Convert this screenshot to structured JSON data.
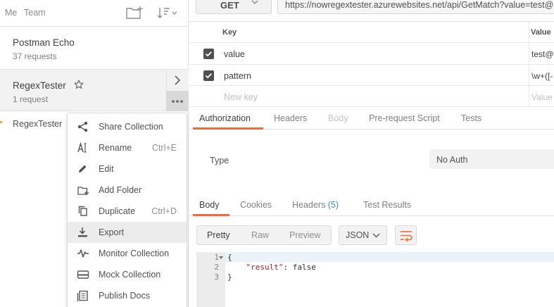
{
  "sidebar": {
    "tabs": {
      "me": "Me",
      "team": "Team"
    },
    "collections": [
      {
        "name": "Postman Echo",
        "sub": "37 requests"
      },
      {
        "name": "RegexTester",
        "sub": "1 request"
      }
    ],
    "request": {
      "name": "RegexTester"
    }
  },
  "context_menu": {
    "items": [
      {
        "label": "Share Collection",
        "shortcut": "",
        "icon": "share-icon"
      },
      {
        "label": "Rename",
        "shortcut": "Ctrl+E",
        "icon": "rename-icon"
      },
      {
        "label": "Edit",
        "shortcut": "",
        "icon": "pencil-icon"
      },
      {
        "label": "Add Folder",
        "shortcut": "",
        "icon": "add-folder-icon"
      },
      {
        "label": "Duplicate",
        "shortcut": "Ctrl+D",
        "icon": "duplicate-icon"
      },
      {
        "label": "Export",
        "shortcut": "",
        "icon": "export-icon",
        "highlighted": true
      },
      {
        "label": "Monitor Collection",
        "shortcut": "",
        "icon": "monitor-icon"
      },
      {
        "label": "Mock Collection",
        "shortcut": "",
        "icon": "mock-icon"
      },
      {
        "label": "Publish Docs",
        "shortcut": "",
        "icon": "docs-icon"
      }
    ]
  },
  "request": {
    "method": "GET",
    "url": "https://nowregextester.azurewebsites.net/api/GetMatch?value=test@"
  },
  "params": {
    "header_key": "Key",
    "header_value": "Value",
    "rows": [
      {
        "key": "value",
        "value": "test@"
      },
      {
        "key": "pattern",
        "value": "\\w+([-"
      }
    ],
    "new_key_placeholder": "New key",
    "new_value_placeholder": "Value"
  },
  "request_tabs": {
    "authorization": "Authorization",
    "headers": "Headers",
    "body": "Body",
    "prerequest": "Pre-request Script",
    "tests": "Tests"
  },
  "auth": {
    "type_label": "Type",
    "selected": "No Auth"
  },
  "response_tabs": {
    "body": "Body",
    "cookies": "Cookies",
    "headers": "Headers",
    "headers_count": "(5)",
    "test_results": "Test Results"
  },
  "response_view": {
    "pretty": "Pretty",
    "raw": "Raw",
    "preview": "Preview",
    "format": "JSON"
  },
  "response_body": {
    "line_numbers": [
      "1",
      "2",
      "3"
    ],
    "open_brace": "{",
    "key": "\"result\"",
    "colon": ": ",
    "value": "false",
    "close_brace": "}"
  },
  "colors": {
    "accent": "#f26b3a",
    "badge": "#3a8bd8"
  }
}
